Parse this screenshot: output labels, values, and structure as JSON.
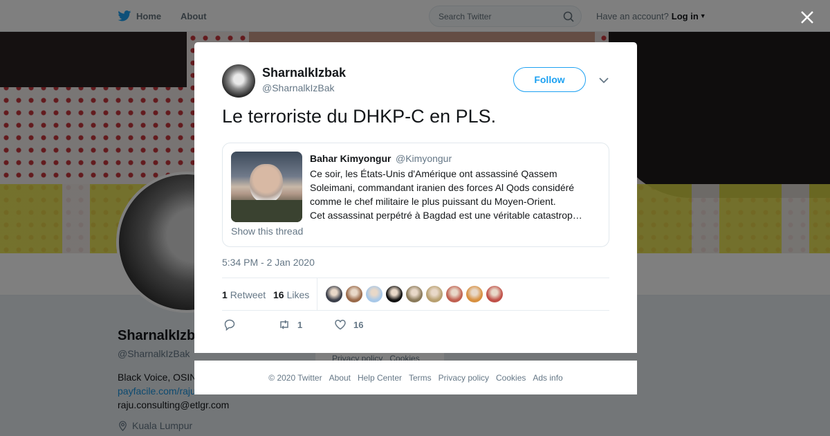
{
  "topnav": {
    "home_label": "Home",
    "about_label": "About",
    "search_placeholder": "Search Twitter",
    "account_prompt": "Have an account?",
    "login_label": "Log in"
  },
  "profile": {
    "name": "SharnalkIzbak",
    "handle": "@SharnalkIzBak",
    "bio": "Black Voice, OSINT",
    "link": "payfacile.com/raju",
    "email": "raju.consulting@etlgr.com",
    "location": "Kuala Lumpur"
  },
  "bg_footer": {
    "privacy": "Privacy policy",
    "cookies": "Cookies"
  },
  "tweet": {
    "author_name": "SharnalkIzbak",
    "author_handle": "@SharnalkIzBak",
    "follow_label": "Follow",
    "text": "Le terroriste du DHKP-C en PLS.",
    "quoted": {
      "author_name": "Bahar Kimyongur",
      "author_handle": "@Kimyongur",
      "lines": [
        "Ce soir, les États-Unis d'Amérique ont assassiné Qassem",
        "Soleimani, commandant iranien des forces Al Qods considéré",
        "comme le chef militaire le plus puissant du Moyen-Orient.",
        "Cet assassinat perpétré à Bagdad est une véritable catastrop…"
      ],
      "show_thread": "Show this thread"
    },
    "timestamp": "5:34 PM - 2 Jan 2020",
    "retweets_count": "1",
    "retweets_label": "Retweet",
    "likes_count": "16",
    "likes_label": "Likes",
    "actions": {
      "retweet_count": "1",
      "like_count": "16"
    }
  },
  "likers_colors": [
    "#3b3f4a",
    "#9a6a4a",
    "#a8c8e8",
    "#111111",
    "#8a7a5a",
    "#b8a070",
    "#c06050",
    "#d89040",
    "#c05048"
  ],
  "footer": {
    "copyright": "© 2020 Twitter",
    "about": "About",
    "help": "Help Center",
    "terms": "Terms",
    "privacy": "Privacy policy",
    "cookies": "Cookies",
    "ads": "Ads info"
  },
  "colors": {
    "accent": "#1da1f2",
    "text": "#14171a",
    "muted": "#657786"
  }
}
